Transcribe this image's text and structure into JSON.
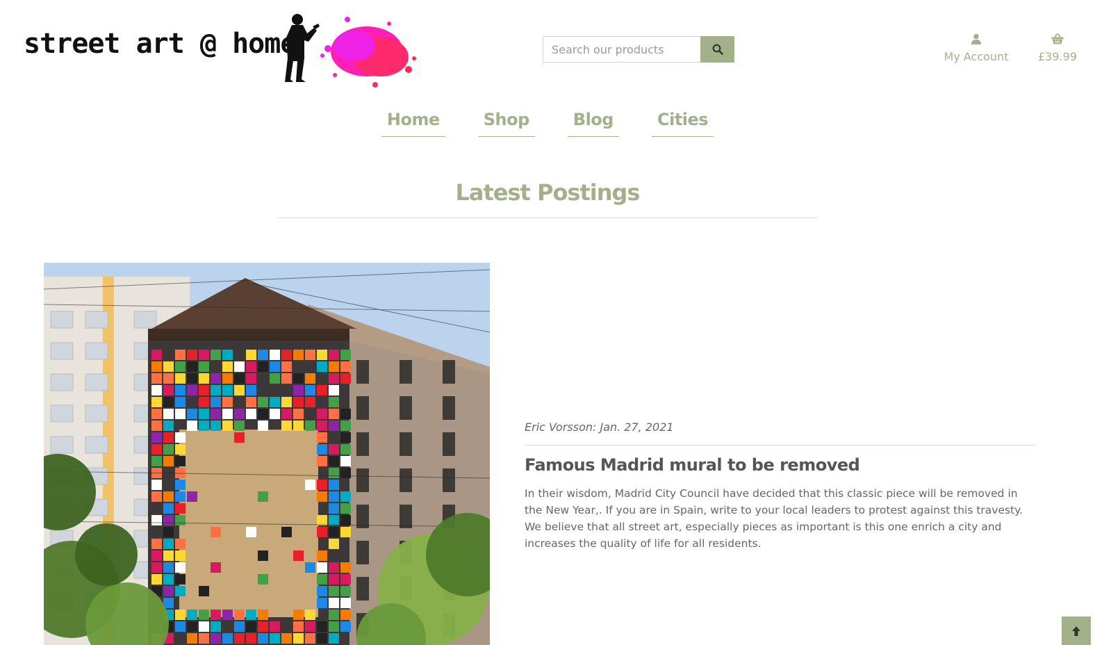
{
  "header": {
    "logo_text": "street art @ home",
    "search": {
      "placeholder": "Search our products",
      "value": ""
    },
    "account_label": "My Account",
    "basket_total": "£39.99"
  },
  "nav": {
    "items": [
      {
        "label": "Home"
      },
      {
        "label": "Shop"
      },
      {
        "label": "Blog"
      },
      {
        "label": "Cities"
      }
    ]
  },
  "main": {
    "section_title": "Latest Postings",
    "post": {
      "author": "Eric Vorsson",
      "date": "Jan. 27, 2021",
      "meta": "Eric Vorsson: Jan. 27, 2021",
      "title": "Famous Madrid mural to be removed",
      "body": "In their wisdom, Madrid City Council have decided that this classic piece will be removed in the New Year,. If you are in Spain, write to your local leaders to protest against this travesty. We believe that all street art, especially pieces as important is this one enrich a city and increases the quality of life for all residents."
    }
  },
  "colors": {
    "accent": "#a3b18a",
    "text": "#555555",
    "splash": "#ff1fb4"
  },
  "icons": {
    "search": "search-icon",
    "account": "user-icon",
    "basket": "basket-icon",
    "to_top": "arrow-up-icon"
  }
}
